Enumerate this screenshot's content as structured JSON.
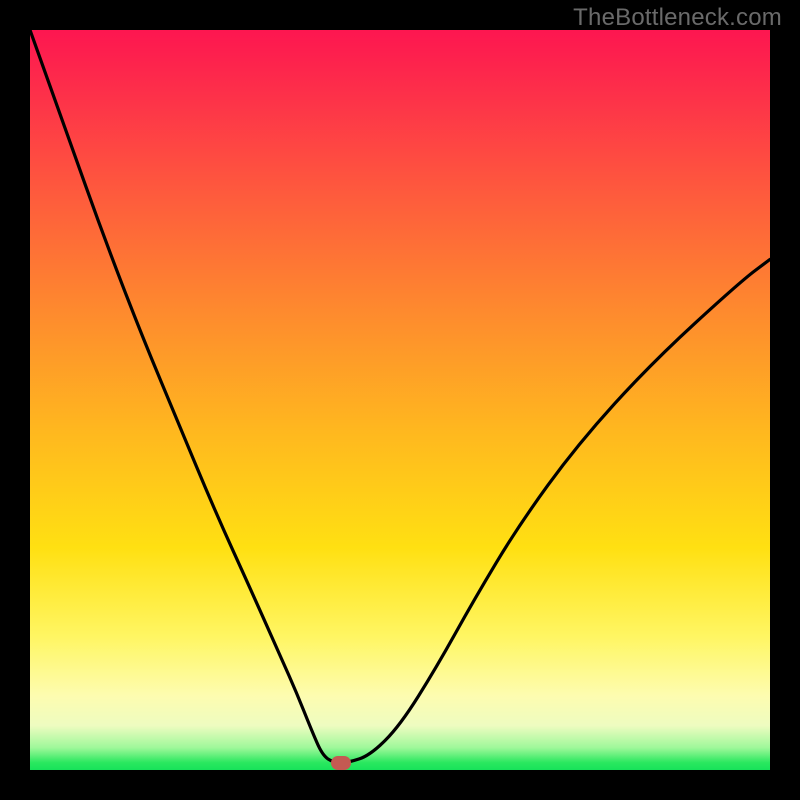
{
  "watermark": "TheBottleneck.com",
  "chart_data": {
    "type": "line",
    "title": "",
    "xlabel": "",
    "ylabel": "",
    "xlim": [
      0,
      100
    ],
    "ylim": [
      0,
      100
    ],
    "grid": false,
    "series": [
      {
        "name": "bottleneck-curve",
        "x": [
          0,
          5,
          10,
          15,
          20,
          25,
          30,
          34,
          36,
          38,
          39.5,
          41,
          43,
          46,
          50,
          55,
          60,
          66,
          74,
          84,
          96,
          100
        ],
        "values": [
          100,
          86,
          72,
          59,
          47,
          35,
          24,
          15,
          10.5,
          5.5,
          2,
          1,
          1,
          2,
          6,
          14,
          23,
          33,
          44,
          55,
          66,
          69
        ]
      }
    ],
    "flat_segment": {
      "x_start": 39.5,
      "x_end": 43,
      "y": 1
    },
    "marker": {
      "x": 42,
      "y": 1,
      "shape": "pill",
      "color": "#c45a52"
    },
    "gradient_stops": [
      {
        "pct": 0,
        "color": "#fd1650"
      },
      {
        "pct": 22,
        "color": "#fe5a3d"
      },
      {
        "pct": 54,
        "color": "#ffb71f"
      },
      {
        "pct": 82,
        "color": "#fff663"
      },
      {
        "pct": 94,
        "color": "#eefcc0"
      },
      {
        "pct": 100,
        "color": "#17e25a"
      }
    ]
  }
}
